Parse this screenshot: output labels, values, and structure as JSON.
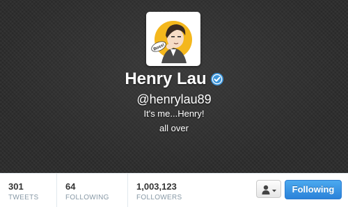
{
  "profile": {
    "name": "Henry Lau",
    "verified": true,
    "handle": "@henrylau89",
    "bio": "It's me...Henry!",
    "location": "all over",
    "avatar_text": "Boss!"
  },
  "stats": [
    {
      "value": "301",
      "label": "TWEETS"
    },
    {
      "value": "64",
      "label": "FOLLOWING"
    },
    {
      "value": "1,003,123",
      "label": "FOLLOWERS"
    }
  ],
  "actions": {
    "following_label": "Following",
    "user_menu_icon": "person-dropdown-icon"
  },
  "colors": {
    "header_bg": "#2b2b2b",
    "verified_blue": "#3b94d9",
    "button_blue": "#2b82d9"
  }
}
